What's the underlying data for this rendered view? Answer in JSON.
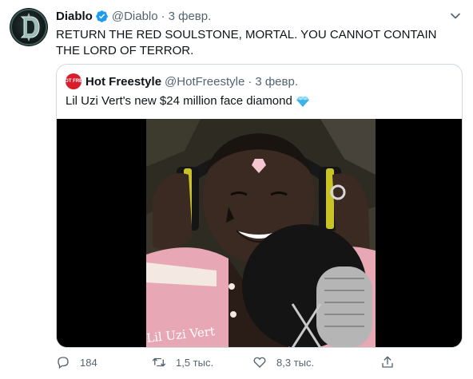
{
  "tweet": {
    "author_name": "Diablo",
    "author_handle": "@Diablo",
    "separator": "·",
    "date": "3 февр.",
    "text": "RETURN THE RED SOULSTONE, MORTAL. YOU CANNOT CONTAIN THE LORD OF TERROR.",
    "avatar_icon": "diablo-d-logo-icon",
    "verified_icon": "verified-badge-icon",
    "menu_icon": "chevron-down-icon"
  },
  "quote": {
    "author_name": "Hot Freestyle",
    "author_handle": "@HotFreestyle",
    "separator": "·",
    "date": "3 февр.",
    "text": "Lil Uzi Vert's new $24 million face diamond",
    "text_emoji": "💎",
    "avatar_label": "HOT FREE",
    "media_caption": "Lil Uzi Vert"
  },
  "actions": {
    "reply_count": "184",
    "retweet_count": "1,5 тыс.",
    "like_count": "8,3 тыс.",
    "reply_icon": "reply-icon",
    "retweet_icon": "retweet-icon",
    "like_icon": "heart-icon",
    "share_icon": "share-icon"
  },
  "colors": {
    "text_primary": "#0f1419",
    "text_secondary": "#536471",
    "verified_blue": "#1d9bf0",
    "border": "#cfd9de"
  }
}
